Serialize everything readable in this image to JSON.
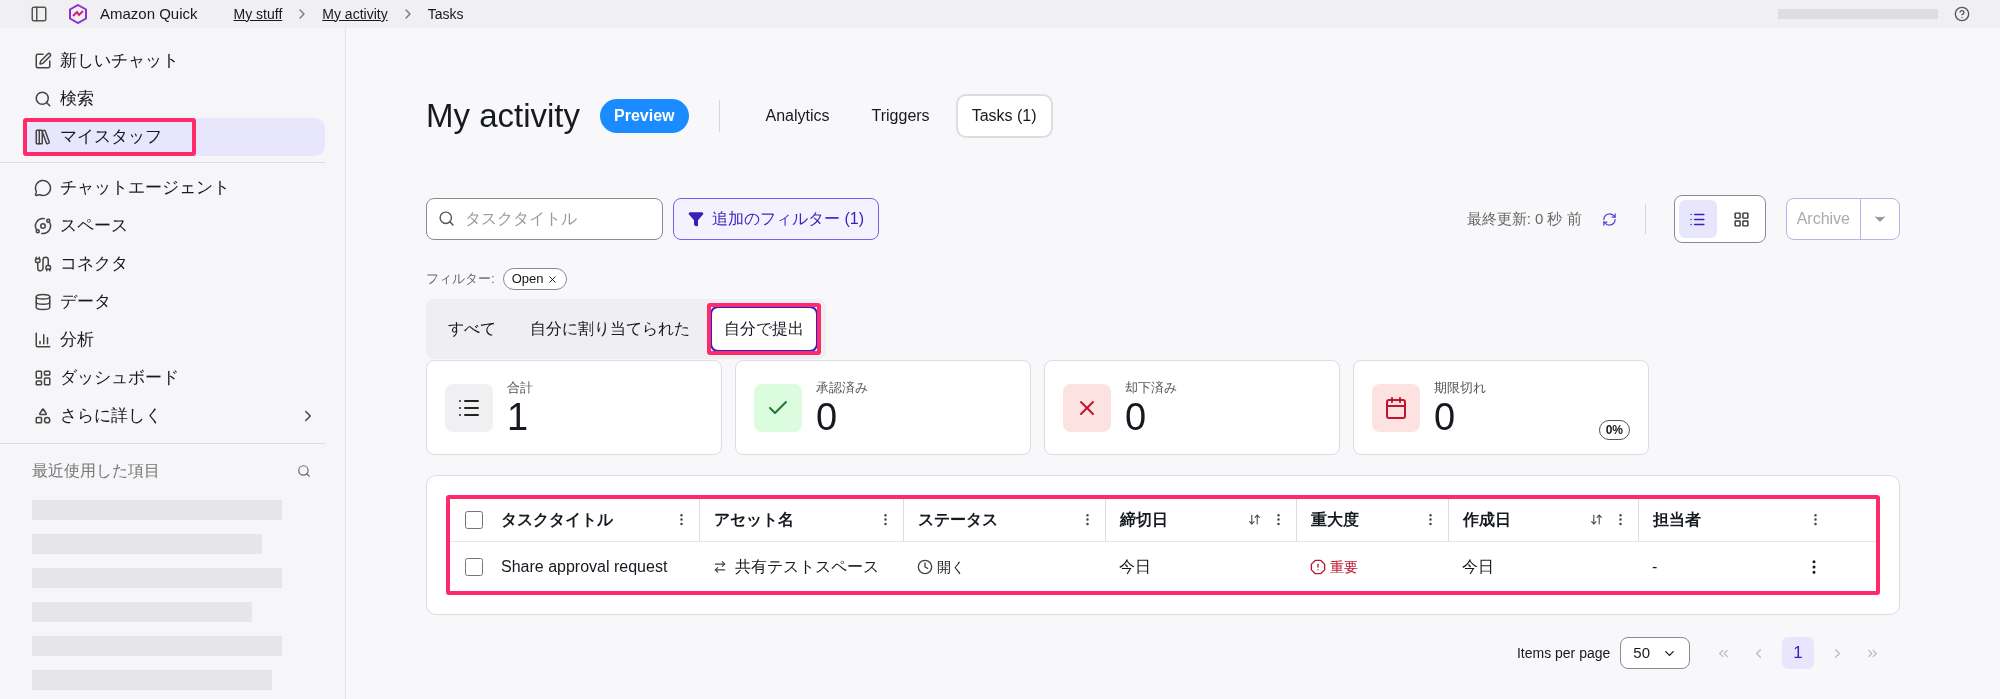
{
  "top_bar": {
    "app_name": "Amazon Quick",
    "breadcrumbs": [
      {
        "label": "My stuff",
        "link": true
      },
      {
        "label": "My activity",
        "link": true
      },
      {
        "label": "Tasks",
        "link": false
      }
    ]
  },
  "sidebar": {
    "items": [
      {
        "kind": "new-chat",
        "label": "新しいチャット",
        "selected": false,
        "highlighted": false
      },
      {
        "kind": "search",
        "label": "検索",
        "selected": false,
        "highlighted": false
      },
      {
        "kind": "library",
        "label": "マイスタッフ",
        "selected": true,
        "highlighted": true
      },
      {
        "kind": "divider"
      },
      {
        "kind": "agent",
        "label": "チャットエージェント",
        "selected": false,
        "highlighted": false
      },
      {
        "kind": "space",
        "label": "スペース",
        "selected": false,
        "highlighted": false
      },
      {
        "kind": "connector",
        "label": "コネクタ",
        "selected": false,
        "highlighted": false
      },
      {
        "kind": "data",
        "label": "データ",
        "selected": false,
        "highlighted": false
      },
      {
        "kind": "analysis",
        "label": "分析",
        "selected": false,
        "highlighted": false
      },
      {
        "kind": "dashboard",
        "label": "ダッシュボード",
        "selected": false,
        "highlighted": false
      },
      {
        "kind": "more",
        "label": "さらに詳しく",
        "selected": false,
        "highlighted": false
      }
    ],
    "recent_title": "最近使用した項目"
  },
  "header": {
    "title": "My activity",
    "badge": "Preview",
    "tabs": [
      {
        "label": "Analytics",
        "selected": false
      },
      {
        "label": "Triggers",
        "selected": false
      },
      {
        "label": "Tasks (1)",
        "selected": true
      }
    ]
  },
  "toolbar": {
    "search_placeholder": "タスクタイトル",
    "filter_button": "追加のフィルター (1)",
    "last_updated": "最終更新: 0 秒 前",
    "views": [
      {
        "kind": "list",
        "selected": true
      },
      {
        "kind": "grid",
        "selected": false
      }
    ],
    "archive_button": "Archive"
  },
  "filters": {
    "label": "フィルター:",
    "chips": [
      "Open"
    ]
  },
  "segments": [
    {
      "label": "すべて",
      "selected": false,
      "highlighted": false
    },
    {
      "label": "自分に割り当てられた",
      "selected": false,
      "highlighted": false
    },
    {
      "label": "自分で提出",
      "selected": true,
      "highlighted": true
    }
  ],
  "stats": [
    {
      "kind": "total",
      "label": "合計",
      "value": "1"
    },
    {
      "kind": "approved",
      "label": "承認済み",
      "value": "0"
    },
    {
      "kind": "rejected",
      "label": "却下済み",
      "value": "0"
    },
    {
      "kind": "overdue",
      "label": "期限切れ",
      "value": "0",
      "badge": "0%"
    }
  ],
  "table": {
    "highlighted": true,
    "select_all_checked": false,
    "columns": [
      {
        "label": "タスクタイトル",
        "sortable": false
      },
      {
        "label": "アセット名",
        "sortable": false
      },
      {
        "label": "ステータス",
        "sortable": false
      },
      {
        "label": "締切日",
        "sortable": true
      },
      {
        "label": "重大度",
        "sortable": false
      },
      {
        "label": "作成日",
        "sortable": true
      },
      {
        "label": "担当者",
        "sortable": false
      }
    ],
    "rows": [
      {
        "checked": false,
        "title": "Share approval request",
        "asset": "共有テストスペース",
        "status": "開く",
        "deadline": "今日",
        "severity": "重要",
        "created": "今日",
        "assignee": "-"
      }
    ]
  },
  "pagination": {
    "items_per_page_label": "Items per page",
    "items_per_page": "50",
    "pages": [
      {
        "label": "1",
        "selected": true
      }
    ]
  }
}
